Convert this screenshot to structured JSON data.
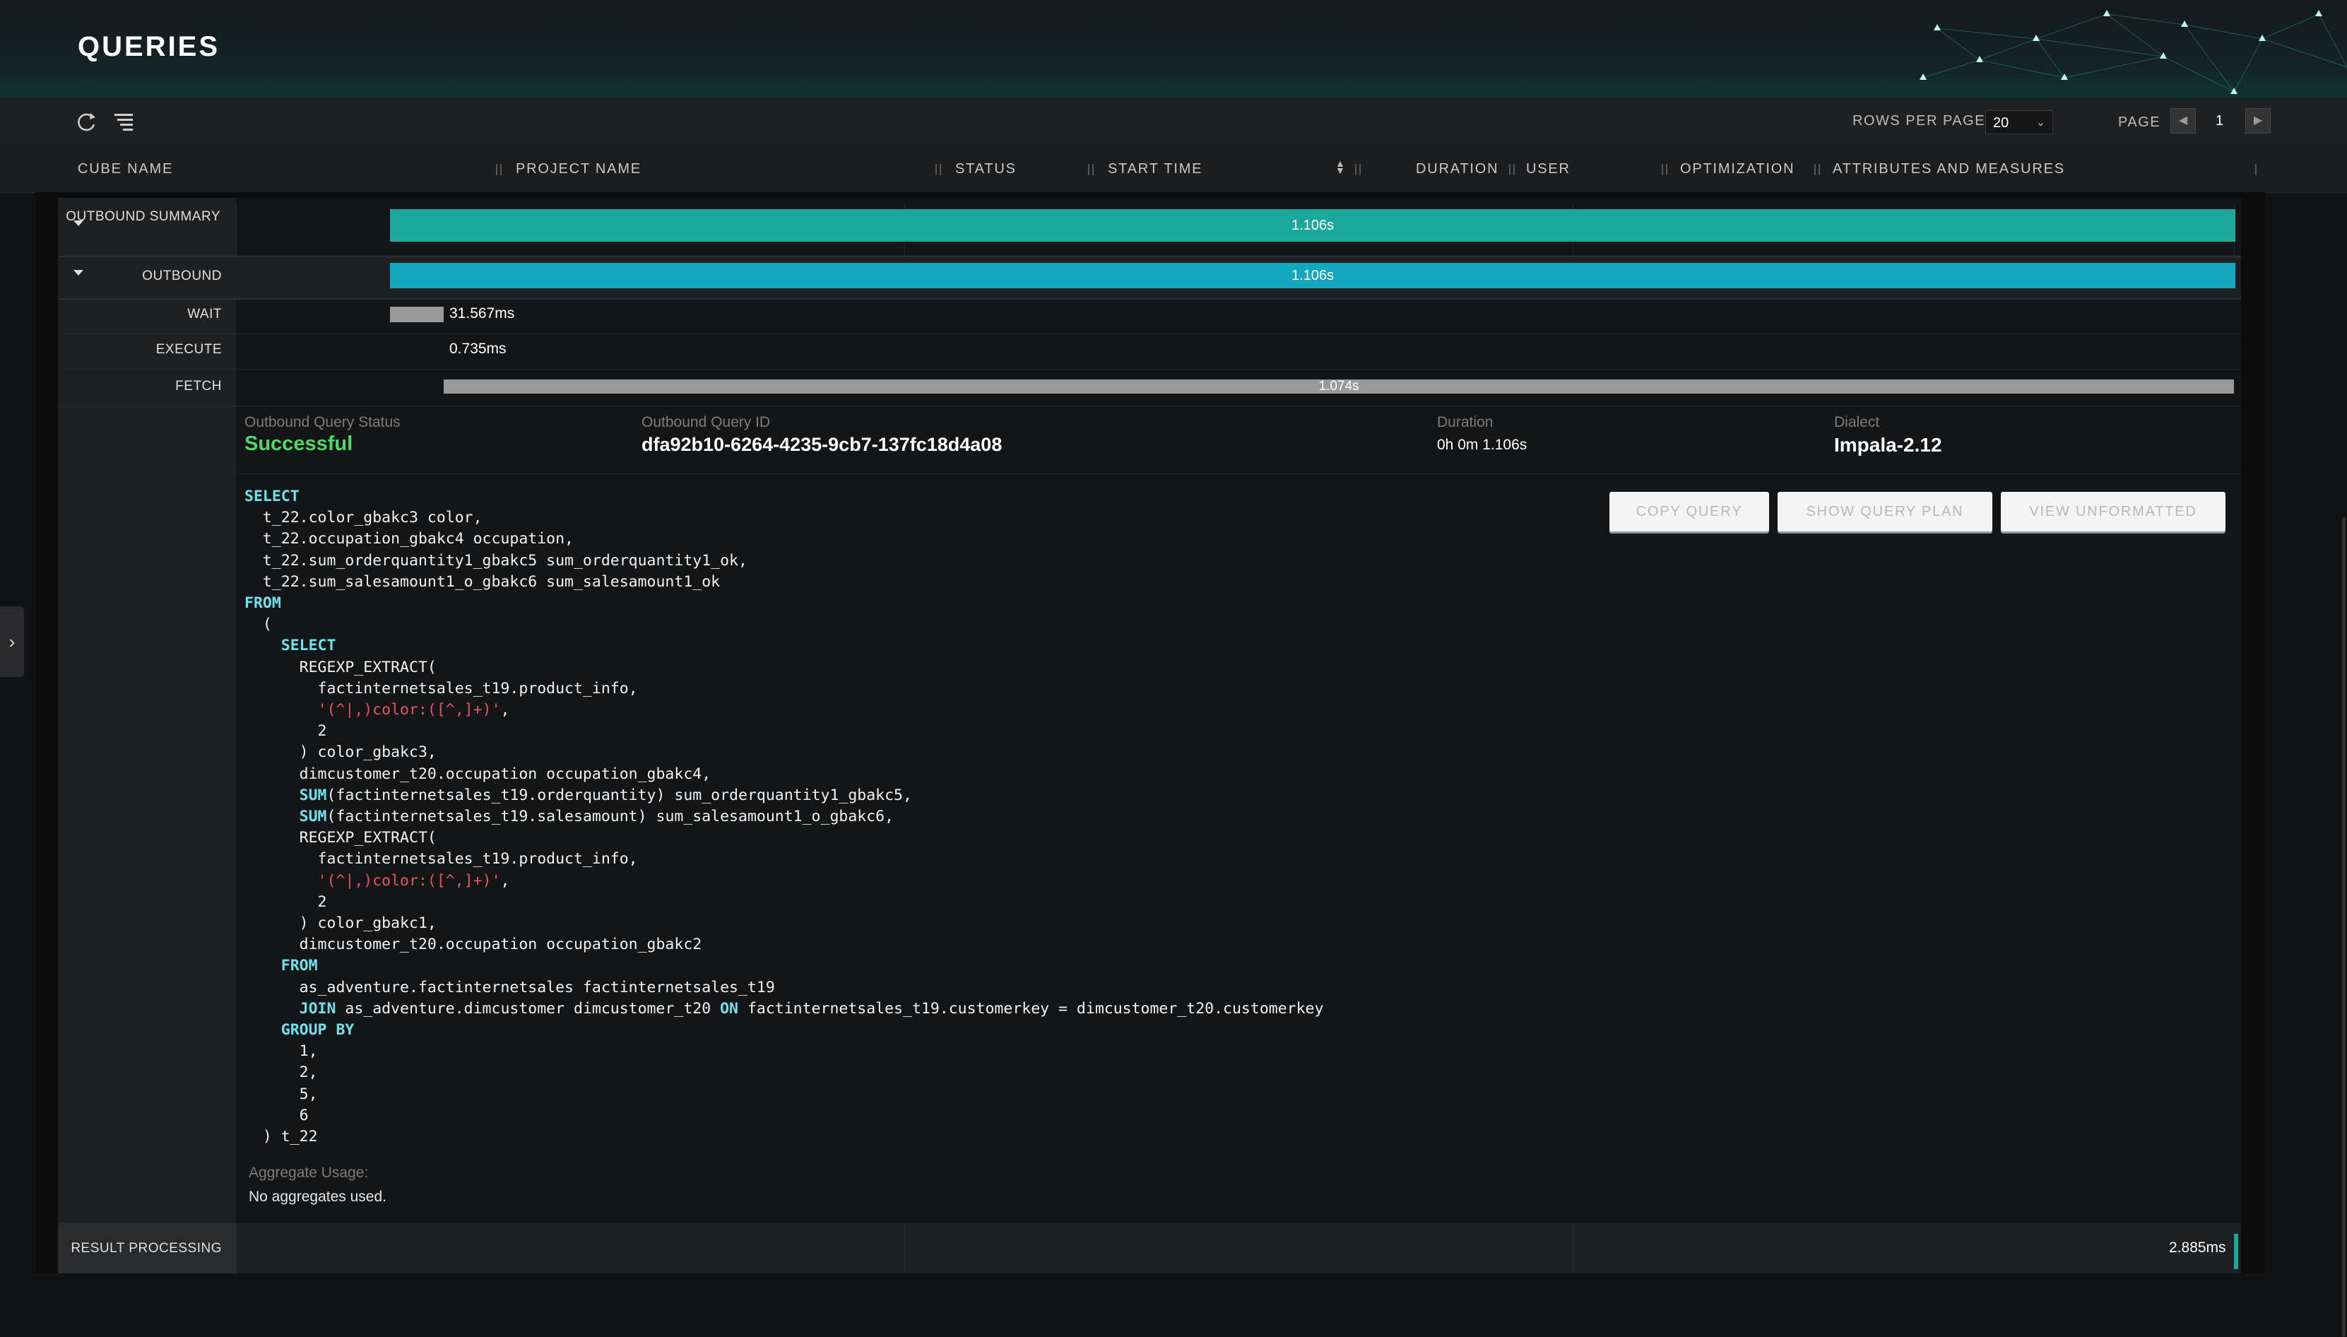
{
  "header": {
    "title": "QUERIES"
  },
  "toolbar": {
    "refresh_icon": "refresh-icon",
    "filter_icon": "filter-list-icon",
    "rows_per_page_label": "ROWS PER PAGE",
    "rows_per_page_value": "20",
    "page_label": "PAGE",
    "page_value": "1"
  },
  "columns": [
    "CUBE NAME",
    "PROJECT NAME",
    "STATUS",
    "START TIME",
    "DURATION",
    "USER",
    "OPTIMIZATION",
    "ATTRIBUTES AND MEASURES"
  ],
  "timeline": {
    "outbound_summary_label": "OUTBOUND SUMMARY",
    "outbound_summary_value": "1.106s",
    "outbound_label": "OUTBOUND",
    "outbound_value": "1.106s",
    "wait_label": "WAIT",
    "wait_value": "31.567ms",
    "execute_label": "EXECUTE",
    "execute_value": "0.735ms",
    "fetch_label": "FETCH",
    "fetch_value": "1.074s"
  },
  "query_info": {
    "status_label": "Outbound Query Status",
    "status_value": "Successful",
    "id_label": "Outbound Query ID",
    "id_value": "dfa92b10-6264-4235-9cb7-137fc18d4a08",
    "duration_label": "Duration",
    "duration_value": "0h 0m 1.106s",
    "dialect_label": "Dialect",
    "dialect_value": "Impala-2.12"
  },
  "buttons": {
    "copy_query": "COPY QUERY",
    "show_query_plan": "SHOW QUERY PLAN",
    "view_unformatted": "VIEW UNFORMATTED"
  },
  "aggregate": {
    "label": "Aggregate Usage:",
    "value": "No aggregates used."
  },
  "result_processing": {
    "label": "RESULT PROCESSING",
    "value": "2.885ms"
  },
  "colors": {
    "summary_bar": "#1aa99b",
    "outbound_bar": "#15a7bd",
    "success": "#4cd964",
    "keyword": "#6fe0ee",
    "string": "#ea5166"
  }
}
